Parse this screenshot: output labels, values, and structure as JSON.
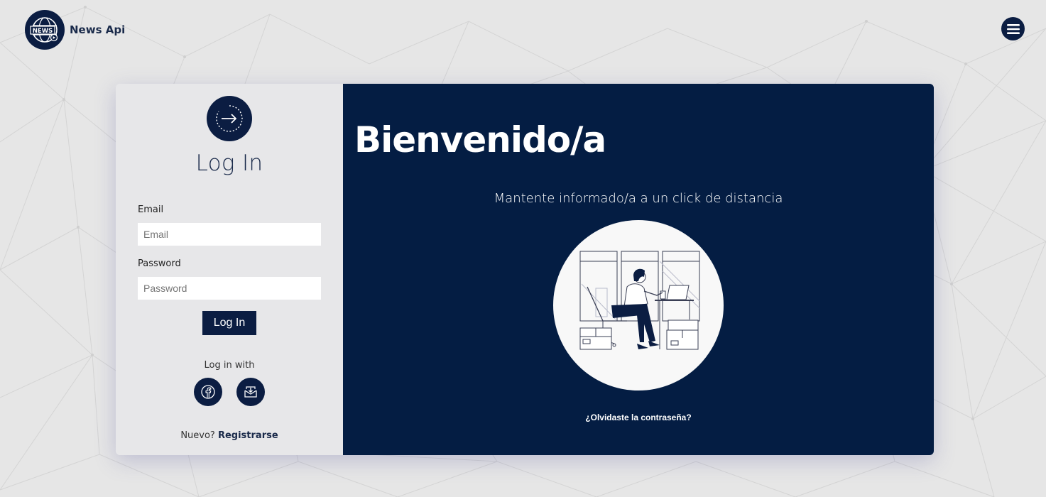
{
  "brand": {
    "name": "News Api",
    "logo_text": "NEWS",
    "logo_icon": "globe-news-logo"
  },
  "menu": {
    "icon": "hamburger-icon"
  },
  "login": {
    "title": "Log In",
    "email_label": "Email",
    "email_placeholder": "Email",
    "email_value": "",
    "password_label": "Password",
    "password_placeholder": "Password",
    "password_value": "",
    "submit_label": "Log In",
    "login_with_label": "Log in with",
    "social": [
      {
        "name": "facebook",
        "icon": "facebook-icon"
      },
      {
        "name": "email",
        "icon": "mail-download-icon"
      }
    ],
    "new_label": "Nuevo?",
    "register_label": "Registrarse"
  },
  "welcome": {
    "title": "Bienvenido/a",
    "subtitle": "Mantente informado/a a un click de distancia",
    "forgot_label": "¿Olvidaste la contraseña?"
  },
  "colors": {
    "primary": "#0b1d42",
    "panel_dark": "#041d43",
    "page_bg": "#e6e6e6",
    "left_panel_bg": "#e7e7e9"
  }
}
